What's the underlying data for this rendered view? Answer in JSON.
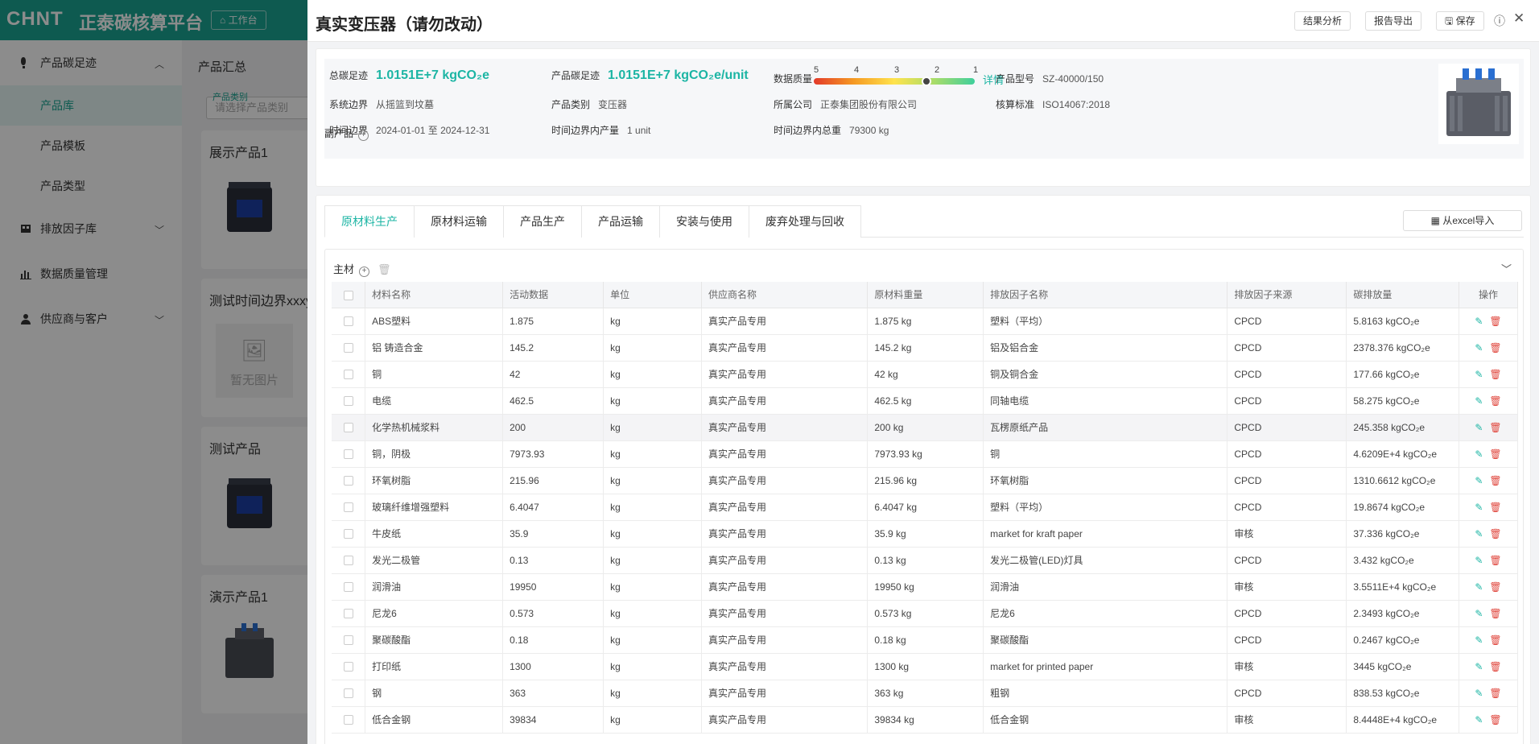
{
  "app": {
    "logo": "CHNT",
    "platform_name": "正泰碳核算平台",
    "workbench": "工作台"
  },
  "sidebar": {
    "groups": [
      {
        "label": "产品碳足迹",
        "icon": "footprint-icon"
      },
      {
        "label": "排放因子库",
        "icon": "database-icon"
      },
      {
        "label": "数据质量管理",
        "icon": "bar-chart-icon"
      },
      {
        "label": "供应商与客户",
        "icon": "users-icon"
      }
    ],
    "items": [
      {
        "label": "产品库"
      },
      {
        "label": "产品模板"
      },
      {
        "label": "产品类型"
      }
    ]
  },
  "background": {
    "card_title": "产品汇总",
    "filter_label": "产品类别",
    "filter_placeholder": "请选择产品类别",
    "products": [
      {
        "name": "展示产品1"
      },
      {
        "name": "测试时间边界xxxyy"
      },
      {
        "name": "测试产品"
      },
      {
        "name": "演示产品1"
      }
    ],
    "no_image": "暂无图片",
    "side_texts": [
      "产",
      "系",
      "产"
    ]
  },
  "drawer": {
    "title": "真实变压器（请勿改动）",
    "buttons": {
      "analysis": "结果分析",
      "export": "报告导出",
      "save": "保存"
    },
    "summary": {
      "total_label": "总碳足迹",
      "total_value": "1.0151E+7 kgCO₂e",
      "product_label": "产品碳足迹",
      "product_value": "1.0151E+7 kgCO₂e/unit",
      "dq_label": "数据质量",
      "dq_ticks": [
        "5",
        "4",
        "3",
        "2",
        "1"
      ],
      "dq_level": 0.7,
      "dq_detail": "详情",
      "model_label": "产品型号",
      "model_value": "SZ-40000/150",
      "boundary_label": "系统边界",
      "boundary_value": "从摇篮到坟墓",
      "category_label": "产品类别",
      "category_value": "变压器",
      "company_label": "所属公司",
      "company_value": "正泰集团股份有限公司",
      "standard_label": "核算标准",
      "standard_value": "ISO14067:2018",
      "time_label": "时间边界",
      "time_value": "2024-01-01 至 2024-12-31",
      "output_label": "时间边界内产量",
      "output_value": "1 unit",
      "weight_label": "时间边界内总重",
      "weight_value": "79300 kg",
      "byproduct_label": "副产品"
    },
    "tabs": [
      "原材料生产",
      "原材料运输",
      "产品生产",
      "产品运输",
      "安装与使用",
      "废弃处理与回收"
    ],
    "excel_import": "从excel导入",
    "section_title": "主材",
    "table": {
      "headers": [
        "材料名称",
        "活动数据",
        "单位",
        "供应商名称",
        "原材料重量",
        "排放因子名称",
        "排放因子来源",
        "碳排放量",
        "操作"
      ],
      "rows": [
        [
          "ABS塑料",
          "1.875",
          "kg",
          "真实产品专用",
          "1.875 kg",
          "塑料（平均）",
          "CPCD",
          "5.8163 kgCO₂e"
        ],
        [
          "铝 铸造合金",
          "145.2",
          "kg",
          "真实产品专用",
          "145.2 kg",
          "铝及铝合金",
          "CPCD",
          "2378.376 kgCO₂e"
        ],
        [
          "铜",
          "42",
          "kg",
          "真实产品专用",
          "42 kg",
          "铜及铜合金",
          "CPCD",
          "177.66 kgCO₂e"
        ],
        [
          "电缆",
          "462.5",
          "kg",
          "真实产品专用",
          "462.5 kg",
          "同轴电缆",
          "CPCD",
          "58.275 kgCO₂e"
        ],
        [
          "化学热机械浆料",
          "200",
          "kg",
          "真实产品专用",
          "200 kg",
          "瓦楞原纸产品",
          "CPCD",
          "245.358 kgCO₂e"
        ],
        [
          "铜，阴极",
          "7973.93",
          "kg",
          "真实产品专用",
          "7973.93 kg",
          "铜",
          "CPCD",
          "4.6209E+4 kgCO₂e"
        ],
        [
          "环氧树脂",
          "215.96",
          "kg",
          "真实产品专用",
          "215.96 kg",
          "环氧树脂",
          "CPCD",
          "1310.6612 kgCO₂e"
        ],
        [
          "玻璃纤维增强塑料",
          "6.4047",
          "kg",
          "真实产品专用",
          "6.4047 kg",
          "塑料（平均）",
          "CPCD",
          "19.8674 kgCO₂e"
        ],
        [
          "牛皮纸",
          "35.9",
          "kg",
          "真实产品专用",
          "35.9 kg",
          "market for kraft paper",
          "审核",
          "37.336 kgCO₂e"
        ],
        [
          "发光二极管",
          "0.13",
          "kg",
          "真实产品专用",
          "0.13 kg",
          "发光二极管(LED)灯具",
          "CPCD",
          "3.432 kgCO₂e"
        ],
        [
          "润滑油",
          "19950",
          "kg",
          "真实产品专用",
          "19950 kg",
          "润滑油",
          "审核",
          "3.5511E+4 kgCO₂e"
        ],
        [
          "尼龙6",
          "0.573",
          "kg",
          "真实产品专用",
          "0.573 kg",
          "尼龙6",
          "CPCD",
          "2.3493 kgCO₂e"
        ],
        [
          "聚碳酸酯",
          "0.18",
          "kg",
          "真实产品专用",
          "0.18 kg",
          "聚碳酸酯",
          "CPCD",
          "0.2467 kgCO₂e"
        ],
        [
          "打印纸",
          "1300",
          "kg",
          "真实产品专用",
          "1300 kg",
          "market for printed paper",
          "审核",
          "3445 kgCO₂e"
        ],
        [
          "钢",
          "363",
          "kg",
          "真实产品专用",
          "363 kg",
          "粗钢",
          "CPCD",
          "838.53 kgCO₂e"
        ],
        [
          "低合金钢",
          "39834",
          "kg",
          "真实产品专用",
          "39834 kg",
          "低合金钢",
          "审核",
          "8.4448E+4 kgCO₂e"
        ]
      ]
    }
  }
}
